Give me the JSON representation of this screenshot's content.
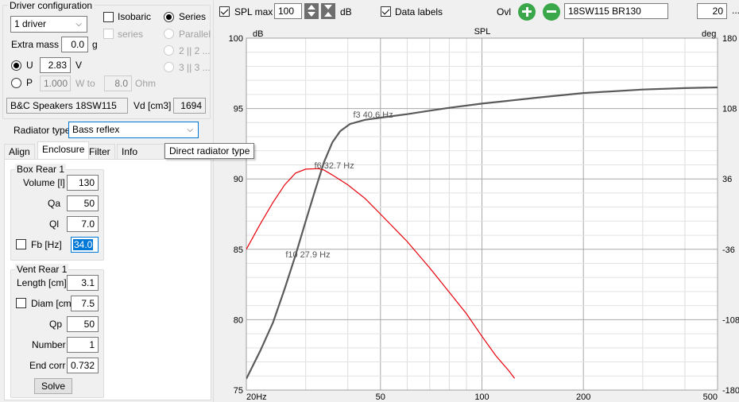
{
  "driver_config": {
    "title": "Driver configuration",
    "count_select": "1 driver",
    "isobaric_label": "Isobaric",
    "series_label": "Series",
    "sub_series_label": "series",
    "parallel_label": "Parallel",
    "opt_2": "2 || 2 ...",
    "opt_3": "3 || 3 ...",
    "extra_mass_label": "Extra mass",
    "extra_mass_value": "0.0",
    "extra_mass_unit": "g",
    "u_label": "U",
    "u_value": "2.83",
    "u_unit": "V",
    "p_label": "P",
    "p_value": "1.000",
    "w_to_label": "W to",
    "ohm_value": "8.0",
    "ohm_unit": "Ohm",
    "driver_name": "B&C Speakers 18SW115",
    "vd_label": "Vd [cm3]",
    "vd_value": "1694"
  },
  "radiator": {
    "label": "Radiator type",
    "value": "Bass reflex",
    "tooltip": "Direct radiator type"
  },
  "tabs": [
    "Align",
    "Enclosure",
    "Filter",
    "Info"
  ],
  "box": {
    "title": "Box Rear 1",
    "volume_label": "Volume [l]",
    "volume": "130",
    "qa_label": "Qa",
    "qa": "50",
    "ql_label": "Ql",
    "ql": "7.0",
    "fb_label": "Fb [Hz]",
    "fb": "34.0"
  },
  "vent": {
    "title": "Vent Rear 1",
    "length_label": "Length [cm]",
    "length": "3.1",
    "diam_label": "Diam [cm]",
    "diam": "7.5",
    "qp_label": "Qp",
    "qp": "50",
    "number_label": "Number",
    "number": "1",
    "endcorr_label": "End corr",
    "endcorr": "0.732",
    "solve_label": "Solve"
  },
  "toolbar": {
    "spl_max_label": "SPL max",
    "spl_max_value": "100",
    "db_label": "dB",
    "data_labels_label": "Data labels",
    "ovl_label": "Ovl",
    "overlay_name": "18SW115 BR130",
    "right_value": "20",
    "more": "..."
  },
  "colors": {
    "spl": "#5a5a5a",
    "phase": "#e8000b",
    "accent": "#0078d7",
    "add_btn": "#3aa84a"
  },
  "chart_data": {
    "type": "line",
    "title": "SPL",
    "ylabel": "dB",
    "y2label": "deg",
    "x_scale": "log",
    "xlim": [
      20,
      500
    ],
    "ylim": [
      75,
      100
    ],
    "y2lim": [
      -180,
      180
    ],
    "x_ticks": [
      20,
      50,
      100,
      200,
      500
    ],
    "x_tick_labels": [
      "20Hz",
      "50",
      "100",
      "200",
      "500"
    ],
    "y_ticks": [
      75,
      80,
      85,
      90,
      95,
      100
    ],
    "y2_ticks": [
      -180,
      -108,
      -36,
      36,
      108,
      180
    ],
    "grid": true,
    "series": [
      {
        "color": "#5a5a5a",
        "axis": "left",
        "points": [
          [
            20,
            75.8
          ],
          [
            22,
            77.8
          ],
          [
            24,
            79.8
          ],
          [
            26,
            82.2
          ],
          [
            28,
            84.6
          ],
          [
            30,
            87.0
          ],
          [
            32,
            89.2
          ],
          [
            34,
            91.2
          ],
          [
            36,
            92.6
          ],
          [
            38,
            93.4
          ],
          [
            40.6,
            93.9
          ],
          [
            45,
            94.2
          ],
          [
            50,
            94.35
          ],
          [
            60,
            94.6
          ],
          [
            70,
            94.85
          ],
          [
            80,
            95.05
          ],
          [
            100,
            95.35
          ],
          [
            150,
            95.8
          ],
          [
            200,
            96.1
          ],
          [
            300,
            96.35
          ],
          [
            400,
            96.45
          ],
          [
            500,
            96.5
          ]
        ]
      },
      {
        "color": "#e8000b",
        "axis": "right",
        "points": [
          [
            20,
            -36
          ],
          [
            22,
            -10
          ],
          [
            24,
            12
          ],
          [
            26,
            30
          ],
          [
            28,
            42
          ],
          [
            30,
            46
          ],
          [
            32.7,
            46.5
          ],
          [
            34,
            45
          ],
          [
            36,
            40
          ],
          [
            40,
            30
          ],
          [
            45,
            16
          ],
          [
            50,
            0
          ],
          [
            60,
            -28
          ],
          [
            70,
            -55
          ],
          [
            80,
            -80
          ],
          [
            90,
            -102
          ],
          [
            100,
            -125
          ],
          [
            110,
            -145
          ],
          [
            120,
            -160
          ],
          [
            125,
            -168
          ]
        ]
      }
    ],
    "annotations": [
      "f3 40.6 Hz",
      "f6 32.7 Hz",
      "f10 27.9 Hz"
    ]
  }
}
